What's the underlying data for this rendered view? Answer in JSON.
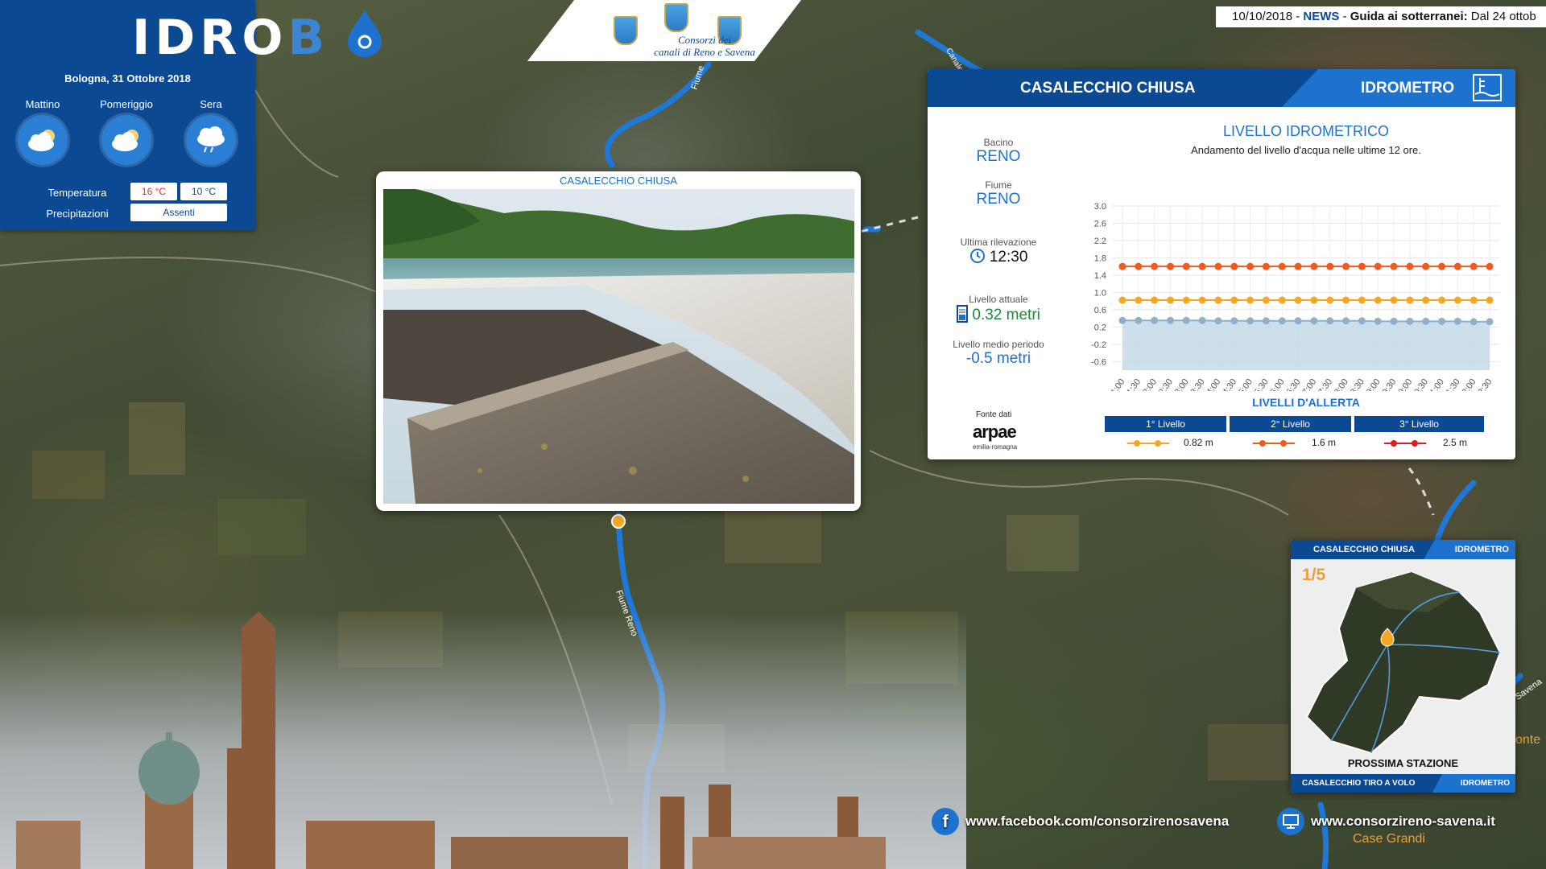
{
  "logo": {
    "text_a": "IDRO",
    "text_b": "B"
  },
  "banner": {
    "line1": "Consorzi dei",
    "line2": "canali di Reno e Savena"
  },
  "ticker": {
    "date": "10/10/2018",
    "sep1": " - ",
    "news": "NEWS",
    "sep2": " - ",
    "text": "Guida ai sotterranei:",
    "rest": " Dal 24 ottob"
  },
  "weather": {
    "date": "Bologna, 31 Ottobre 2018",
    "periods": [
      {
        "label": "Mattino",
        "icon": "cloud-sun-icon"
      },
      {
        "label": "Pomeriggio",
        "icon": "cloud-sun-icon"
      },
      {
        "label": "Sera",
        "icon": "rain-cloud-icon"
      }
    ],
    "temperature_label": "Temperatura",
    "temp_max": "16 °C",
    "temp_min": "10 °C",
    "precip_label": "Precipitazioni",
    "precip_value": "Assenti",
    "colors": {
      "max": "#e03030",
      "min": "#0b4a92"
    }
  },
  "photo": {
    "title": "CASALECCHIO CHIUSA"
  },
  "panel": {
    "title": "CASALECCHIO CHIUSA",
    "type": "IDROMETRO",
    "bacino_label": "Bacino",
    "bacino": "RENO",
    "fiume_label": "Fiume",
    "fiume": "RENO",
    "ultima_label": "Ultima rilevazione",
    "ultima": "12:30",
    "attuale_label": "Livello attuale",
    "attuale": "0.32 metri",
    "medio_label": "Livello medio periodo",
    "medio": "-0.5 metri",
    "fonte_label": "Fonte dati",
    "fonte": "arpae",
    "fonte_sub": "emilia-romagna",
    "chart_title": "LIVELLO IDROMETRICO",
    "chart_subtitle": "Andamento del livello d'acqua nelle ultime 12 ore.",
    "alert_title": "LIVELLI D'ALLERTA",
    "alerts": [
      {
        "label": "1° Livello",
        "value": "0.82 m",
        "color": "#f5a623"
      },
      {
        "label": "2° Livello",
        "value": "1.6 m",
        "color": "#f05a1a"
      },
      {
        "label": "3° Livello",
        "value": "2.5 m",
        "color": "#d42020"
      }
    ]
  },
  "chart_data": {
    "type": "line",
    "title": "LIVELLO IDROMETRICO",
    "subtitle": "Andamento del livello d'acqua nelle ultime 12 ore.",
    "x": [
      "01:00",
      "01:30",
      "02:00",
      "02:30",
      "03:00",
      "03:30",
      "04:00",
      "04:30",
      "05:00",
      "05:30",
      "06:00",
      "06:30",
      "07:00",
      "07:30",
      "08:00",
      "08:30",
      "09:00",
      "09:30",
      "10:00",
      "10:30",
      "11:00",
      "11:30",
      "12:00",
      "12:30"
    ],
    "y_ticks": [
      "3.0",
      "2.6",
      "2.2",
      "1.8",
      "1.4",
      "1.0",
      "0.6",
      "0.2",
      "-0.2",
      "-0.6"
    ],
    "ylim": [
      -0.8,
      3.0
    ],
    "grid": true,
    "series": [
      {
        "color": "#f05a1a",
        "values": [
          1.6,
          1.6,
          1.6,
          1.6,
          1.6,
          1.6,
          1.6,
          1.6,
          1.6,
          1.6,
          1.6,
          1.6,
          1.6,
          1.6,
          1.6,
          1.6,
          1.6,
          1.6,
          1.6,
          1.6,
          1.6,
          1.6,
          1.6,
          1.6
        ],
        "kind": "line"
      },
      {
        "color": "#f5a623",
        "values": [
          0.82,
          0.82,
          0.82,
          0.82,
          0.82,
          0.82,
          0.82,
          0.82,
          0.82,
          0.82,
          0.82,
          0.82,
          0.82,
          0.82,
          0.82,
          0.82,
          0.82,
          0.82,
          0.82,
          0.82,
          0.82,
          0.82,
          0.82,
          0.82
        ],
        "kind": "line"
      },
      {
        "color": "#8fb0c8",
        "values": [
          0.35,
          0.35,
          0.35,
          0.35,
          0.35,
          0.35,
          0.34,
          0.34,
          0.34,
          0.34,
          0.34,
          0.34,
          0.34,
          0.34,
          0.34,
          0.34,
          0.33,
          0.33,
          0.33,
          0.33,
          0.33,
          0.33,
          0.32,
          0.32
        ],
        "kind": "area"
      }
    ]
  },
  "mini": {
    "station": "CASALECCHIO CHIUSA",
    "type": "IDROMETRO",
    "count": "1/5",
    "next_label": "PROSSIMA STAZIONE",
    "next_station": "CASALECCHIO TIRO A VOLO",
    "next_type": "IDROMETRO"
  },
  "map_labels": {
    "river1": "Fiume",
    "river2": "Fiume Reno",
    "river3": "Canale",
    "place1": "Case Grandi",
    "place2": "Savena",
    "place3": "onte"
  },
  "social": {
    "facebook": "www.facebook.com/consorzirenosavena",
    "website": "www.consorzireno-savena.it"
  }
}
